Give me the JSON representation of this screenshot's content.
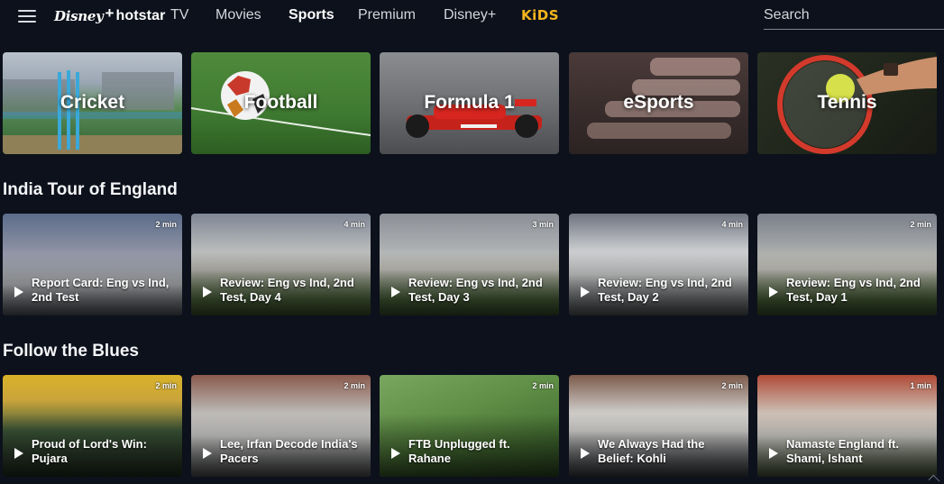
{
  "header": {
    "logo": {
      "disney": "Disney",
      "plus": "+",
      "hotstar": "hotstar"
    },
    "nav": [
      {
        "id": "tv",
        "label": "TV"
      },
      {
        "id": "movies",
        "label": "Movies"
      },
      {
        "id": "sports",
        "label": "Sports",
        "active": true
      },
      {
        "id": "premium",
        "label": "Premium"
      },
      {
        "id": "disney-plus",
        "label": "Disney+"
      },
      {
        "id": "kids",
        "label": "KiDS"
      }
    ],
    "search_placeholder": "Search"
  },
  "sports": [
    {
      "label": "Cricket",
      "icon": "cricket-stumps-icon"
    },
    {
      "label": "Football",
      "icon": "football-ball-icon"
    },
    {
      "label": "Formula 1",
      "icon": "f1-car-icon"
    },
    {
      "label": "eSports",
      "icon": "gamepad-icon"
    },
    {
      "label": "Tennis",
      "icon": "tennis-racket-icon"
    }
  ],
  "sections": [
    {
      "title": "India Tour of England",
      "cards": [
        {
          "duration": "2 min",
          "title": "Report Card: Eng vs Ind, 2nd Test"
        },
        {
          "duration": "4 min",
          "title": "Review: Eng vs Ind, 2nd Test, Day 4"
        },
        {
          "duration": "3 min",
          "title": "Review: Eng vs Ind, 2nd Test, Day 3"
        },
        {
          "duration": "4 min",
          "title": "Review: Eng vs Ind, 2nd Test, Day 2"
        },
        {
          "duration": "2 min",
          "title": "Review: Eng vs Ind, 2nd Test, Day 1"
        }
      ]
    },
    {
      "title": "Follow the Blues",
      "cards": [
        {
          "duration": "2 min",
          "title": "Proud of Lord's Win: Pujara"
        },
        {
          "duration": "2 min",
          "title": "Lee, Irfan Decode India's Pacers"
        },
        {
          "duration": "2 min",
          "title": "FTB Unplugged ft. Rahane"
        },
        {
          "duration": "2 min",
          "title": "We Always Had the Belief: Kohli"
        },
        {
          "duration": "1 min",
          "title": "Namaste England ft. Shami, Ishant"
        }
      ]
    }
  ],
  "colors": {
    "background": "#0c111b",
    "nav_text": "#d3d6dc",
    "kids": "#f5b51d"
  }
}
